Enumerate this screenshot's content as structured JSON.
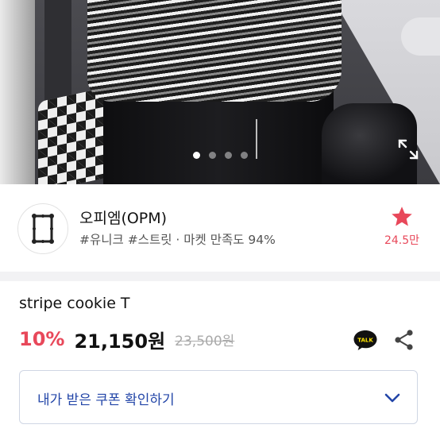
{
  "gallery": {
    "dots_total": 4,
    "active_index": 0
  },
  "shop": {
    "name": "오피엠(OPM)",
    "tags": "#유니크 #스트릿 · 마켓 만족도 94%",
    "favorite_count": "24.5만"
  },
  "product": {
    "title": "stripe cookie T",
    "discount": "10%",
    "price": "21,150원",
    "original_price": "23,500원"
  },
  "actions": {
    "talk_icon_label": "TALK"
  },
  "coupon": {
    "label": "내가 받은 쿠폰 확인하기"
  },
  "colors": {
    "accent": "#e8485a",
    "link": "#2346a8",
    "talk_bubble": "#000000",
    "talk_bg": "#fee500"
  }
}
